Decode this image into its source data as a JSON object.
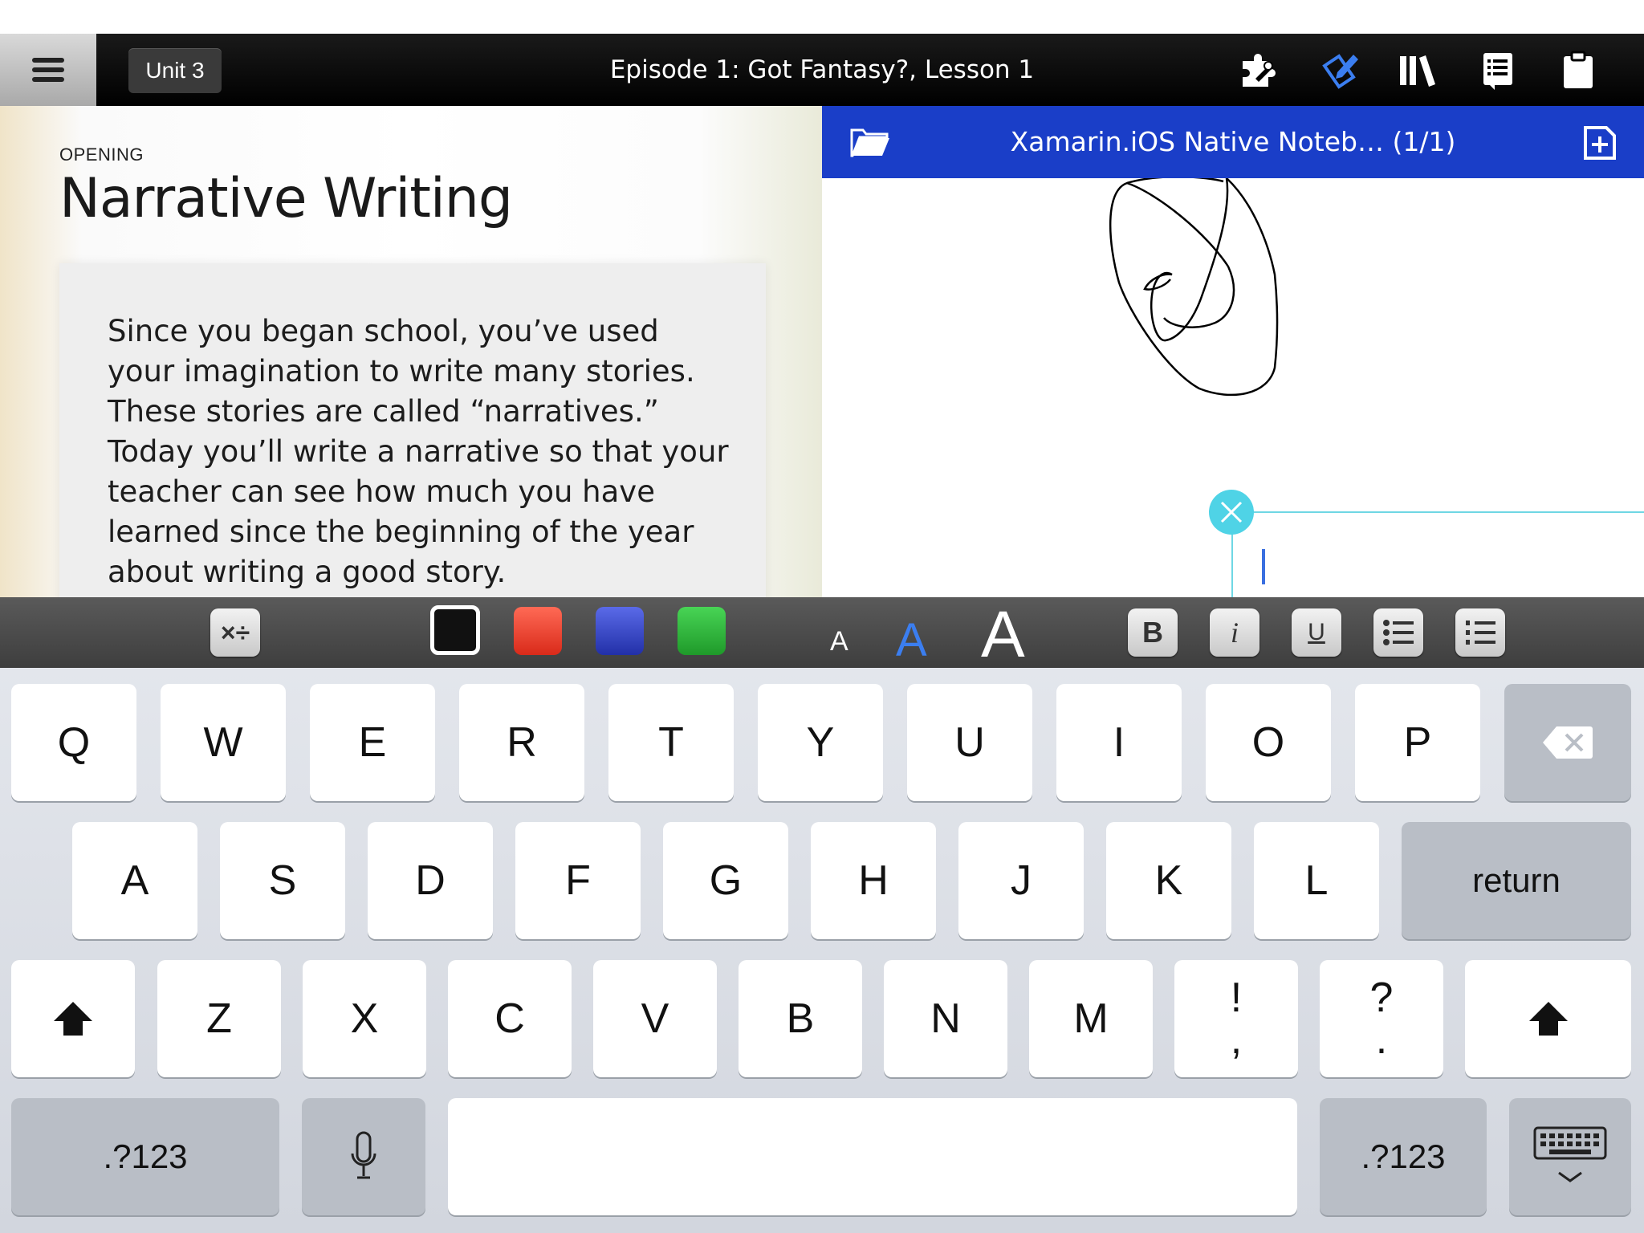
{
  "nav": {
    "back_label": "Unit 3",
    "title": "Episode 1: Got Fantasy?, Lesson 1",
    "icons": [
      "puzzle-tools-icon",
      "pencil-notebook-icon",
      "library-icon",
      "list-notes-icon",
      "clipboard-icon"
    ]
  },
  "lesson": {
    "section_label": "OPENING",
    "title": "Narrative Writing",
    "body": "Since you began school, you’ve used your imagination to write many stories. These stories are called “narratives.” Today you’ll write a narrative so that your teacher can see how much you have learned since the beginning of the year about writing a good story."
  },
  "notebook": {
    "title": "Xamarin.iOS Native Noteb… (1/1)",
    "accent": "#1a3ec8"
  },
  "toolbar": {
    "math_label": "×÷",
    "colors": [
      "#111111",
      "#e8392b",
      "#2f3fc2",
      "#2db13a"
    ],
    "size_small": "A",
    "size_medium": "A",
    "size_large": "A",
    "bold": "B",
    "italic": "i",
    "underline": "U"
  },
  "keyboard": {
    "row1": [
      "Q",
      "W",
      "E",
      "R",
      "T",
      "Y",
      "U",
      "I",
      "O",
      "P"
    ],
    "row2": [
      "A",
      "S",
      "D",
      "F",
      "G",
      "H",
      "J",
      "K",
      "L"
    ],
    "return_label": "return",
    "row3": [
      "Z",
      "X",
      "C",
      "V",
      "B",
      "N",
      "M"
    ],
    "punct1_top": "!",
    "punct1_bottom": ",",
    "punct2_top": "?",
    "punct2_bottom": ".",
    "numbers_label": ".?123"
  }
}
